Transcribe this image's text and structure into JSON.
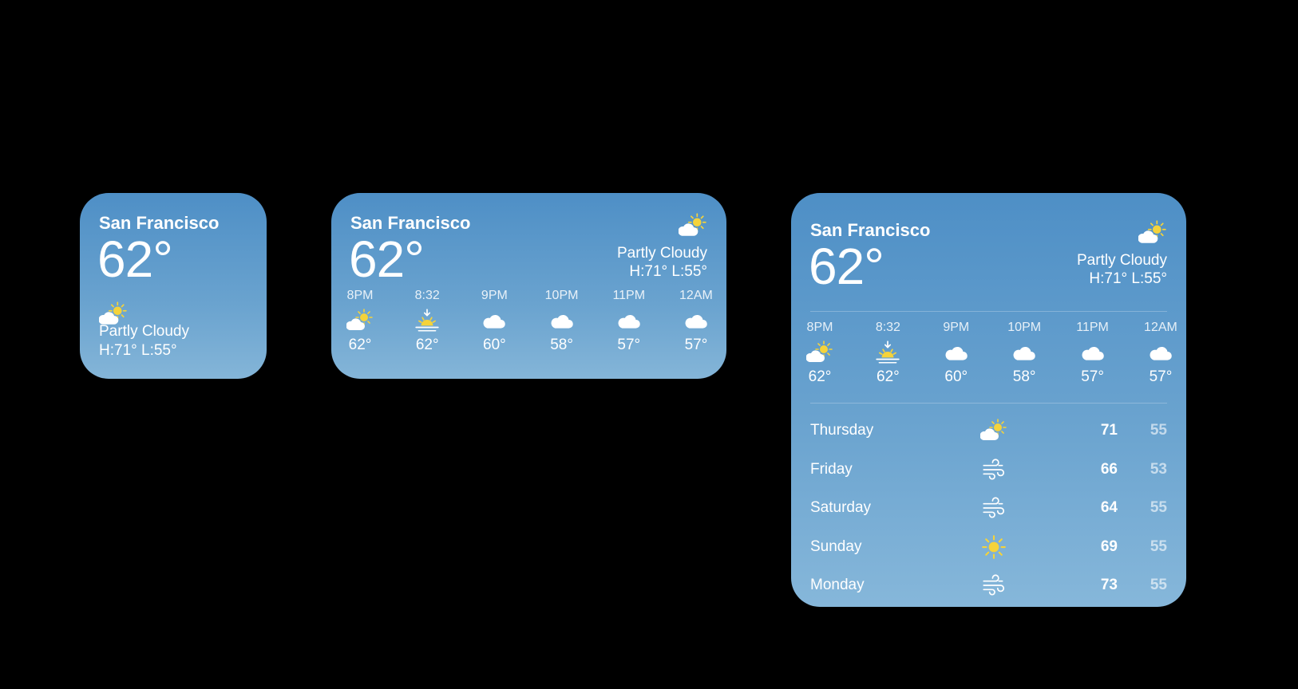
{
  "small": {
    "city": "San Francisco",
    "temp": "62°",
    "icon": "partly-cloudy-icon",
    "condition": "Partly Cloudy",
    "hilo": "H:71° L:55°"
  },
  "medium": {
    "city": "San Francisco",
    "temp": "62°",
    "icon": "partly-cloudy-icon",
    "condition": "Partly Cloudy",
    "hilo": "H:71° L:55°",
    "hourly": [
      {
        "time": "8PM",
        "icon": "partly-cloudy-icon",
        "temp": "62°"
      },
      {
        "time": "8:32",
        "icon": "sunset-icon",
        "temp": "62°"
      },
      {
        "time": "9PM",
        "icon": "cloud-icon",
        "temp": "60°"
      },
      {
        "time": "10PM",
        "icon": "cloud-icon",
        "temp": "58°"
      },
      {
        "time": "11PM",
        "icon": "cloud-icon",
        "temp": "57°"
      },
      {
        "time": "12AM",
        "icon": "cloud-icon",
        "temp": "57°"
      }
    ]
  },
  "large": {
    "city": "San Francisco",
    "temp": "62°",
    "icon": "partly-cloudy-icon",
    "condition": "Partly Cloudy",
    "hilo": "H:71° L:55°",
    "hourly": [
      {
        "time": "8PM",
        "icon": "partly-cloudy-icon",
        "temp": "62°"
      },
      {
        "time": "8:32",
        "icon": "sunset-icon",
        "temp": "62°"
      },
      {
        "time": "9PM",
        "icon": "cloud-icon",
        "temp": "60°"
      },
      {
        "time": "10PM",
        "icon": "cloud-icon",
        "temp": "58°"
      },
      {
        "time": "11PM",
        "icon": "cloud-icon",
        "temp": "57°"
      },
      {
        "time": "12AM",
        "icon": "cloud-icon",
        "temp": "57°"
      }
    ],
    "daily": [
      {
        "day": "Thursday",
        "icon": "partly-cloudy-icon",
        "high": "71",
        "low": "55"
      },
      {
        "day": "Friday",
        "icon": "wind-icon",
        "high": "66",
        "low": "53"
      },
      {
        "day": "Saturday",
        "icon": "wind-icon",
        "high": "64",
        "low": "55"
      },
      {
        "day": "Sunday",
        "icon": "sun-icon",
        "high": "69",
        "low": "55"
      },
      {
        "day": "Monday",
        "icon": "wind-icon",
        "high": "73",
        "low": "55"
      }
    ]
  },
  "colors": {
    "background": "#000000",
    "widget_top": "#4e8fc6",
    "widget_bottom": "#84b5d8",
    "sun": "#f5d33a"
  }
}
